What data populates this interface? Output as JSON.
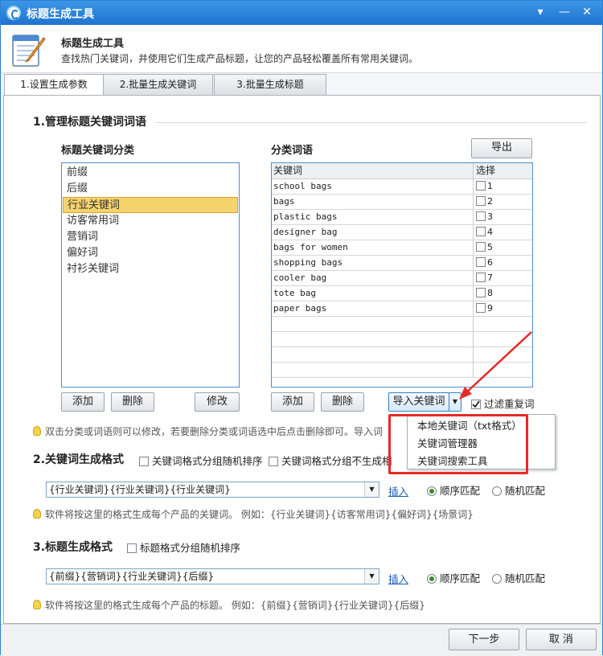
{
  "window": {
    "title": "标题生成工具",
    "controls": [
      "▾",
      "—",
      "✕"
    ]
  },
  "header": {
    "title": "标题生成工具",
    "description": "查找热门关键词，并使用它们生成产品标题，让您的产品轻松覆盖所有常用关键词。"
  },
  "tabs": [
    {
      "label": "1.设置生成参数",
      "active": true
    },
    {
      "label": "2.批量生成关键词",
      "active": false
    },
    {
      "label": "3.批量生成标题",
      "active": false
    }
  ],
  "section1": {
    "title": "1.管理标题关键词词语",
    "category_label": "标题关键词分类",
    "categories": [
      "前缀",
      "后缀",
      "行业关键词",
      "访客常用词",
      "营销词",
      "偏好词",
      "衬衫关键词"
    ],
    "selected_category_index": 2,
    "words_label": "分类词语",
    "export_label": "导出",
    "table": {
      "headers": [
        "关键词",
        "选择"
      ],
      "rows": [
        {
          "keyword": "school bags",
          "index": "1"
        },
        {
          "keyword": "bags",
          "index": "2"
        },
        {
          "keyword": "plastic bags",
          "index": "3"
        },
        {
          "keyword": "designer bag",
          "index": "4"
        },
        {
          "keyword": "bags for women",
          "index": "5"
        },
        {
          "keyword": "shopping bags",
          "index": "6"
        },
        {
          "keyword": "cooler bag",
          "index": "7"
        },
        {
          "keyword": "tote bag",
          "index": "8"
        },
        {
          "keyword": "paper bags",
          "index": "9"
        }
      ]
    },
    "left_buttons": {
      "add": "添加",
      "delete": "删除",
      "modify": "修改"
    },
    "right_buttons": {
      "add": "添加",
      "delete": "删除",
      "import": "导入关键词"
    },
    "filter_label": "过滤重复词",
    "tip": "双击分类或词语则可以修改，若要删除分类或词语选中后点击删除即可。导入词"
  },
  "import_menu": [
    "本地关键词（txt格式）",
    "关键词管理器",
    "关键词搜索工具"
  ],
  "section2": {
    "title": "2.关键词生成格式",
    "option1": "关键词格式分组随机排序",
    "option2": "关键词格式分组不生成相",
    "format": "{行业关键词}{行业关键词}{行业关键词}",
    "insert": "插入",
    "radio_seq": "顺序匹配",
    "radio_rand": "随机匹配",
    "tip": "软件将按这里的格式生成每个产品的关键词。 例如：{行业关键词}{访客常用词}{偏好词}{场景词}"
  },
  "section3": {
    "title": "3.标题生成格式",
    "option1": "标题格式分组随机排序",
    "format": "{前缀}{营销词}{行业关键词}{后缀}",
    "insert": "插入",
    "radio_seq": "顺序匹配",
    "radio_rand": "随机匹配",
    "tip": "软件将按这里的格式生成每个产品的标题。 例如：{前缀}{营销词}{行业关键词}{后缀}"
  },
  "footer": {
    "next": "下一步",
    "cancel": "取 消"
  }
}
